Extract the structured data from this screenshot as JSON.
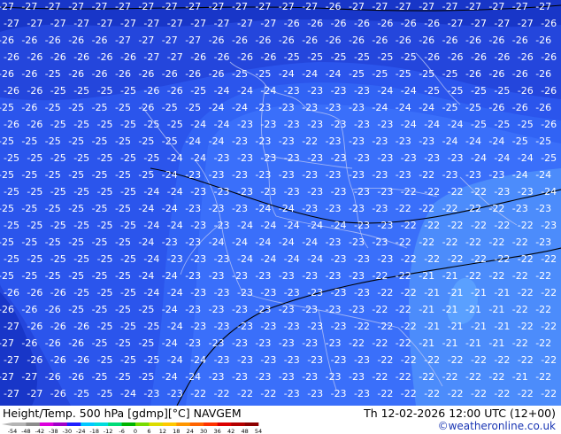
{
  "title": {
    "left": "Height/Temp. 500 hPa [gdmp][°C] NAVGEM",
    "right": "Th 12-02-2026 12:00 UTC (12+00)"
  },
  "credit": "©weatheronline.co.uk",
  "colorbar": {
    "ticks": [
      "-54",
      "-48",
      "-42",
      "-38",
      "-30",
      "-24",
      "-18",
      "-12",
      "-6",
      "0",
      "6",
      "12",
      "18",
      "24",
      "30",
      "36",
      "42",
      "48",
      "54"
    ],
    "colors": [
      "#b4b4b4",
      "#8c8c8c",
      "#dc00dc",
      "#a000c8",
      "#1e1eff",
      "#00c8ff",
      "#00dcdc",
      "#00dc78",
      "#00b400",
      "#78dc00",
      "#dcdc00",
      "#ffc800",
      "#ff9600",
      "#ff6400",
      "#ff3200",
      "#dc0000",
      "#b40000",
      "#8c0000"
    ]
  },
  "field": {
    "label_color": "#ffffff",
    "colors": {
      "c27": "#1836c8",
      "c26": "#2446dc",
      "c25": "#2b55ec",
      "c24": "#3163f4",
      "c23": "#3a6ffa",
      "c22": "#4c8cfb",
      "c21": "#5aa0ff"
    },
    "rows": [
      [
        -27,
        -27,
        -27,
        -27,
        -27,
        -27,
        -27,
        -27,
        -27,
        -27,
        -27,
        -27,
        -27,
        -27,
        -26,
        -27,
        -27,
        -27,
        -27,
        -27,
        -27,
        -27,
        -27,
        -27
      ],
      [
        -27,
        -27,
        -27,
        -27,
        -27,
        -27,
        -27,
        -27,
        -27,
        -27,
        -27,
        -27,
        -26,
        -26,
        -26,
        -26,
        -26,
        -26,
        -26,
        -27,
        -27,
        -27,
        -27,
        -26
      ],
      [
        -26,
        -26,
        -26,
        -26,
        -26,
        -27,
        -27,
        -27,
        -27,
        -26,
        -26,
        -26,
        -26,
        -26,
        -26,
        -26,
        -26,
        -26,
        -26,
        -26,
        -26,
        -26,
        -26,
        -26
      ],
      [
        -26,
        -26,
        -26,
        -26,
        -26,
        -26,
        -27,
        -27,
        -26,
        -26,
        -26,
        -26,
        -25,
        -25,
        -25,
        -25,
        -25,
        -25,
        -26,
        -26,
        -26,
        -26,
        -26,
        -26
      ],
      [
        -26,
        -26,
        -25,
        -26,
        -26,
        -26,
        -26,
        -26,
        -26,
        -26,
        -25,
        -25,
        -24,
        -24,
        -24,
        -25,
        -25,
        -25,
        -25,
        -25,
        -26,
        -26,
        -26,
        -26
      ],
      [
        -26,
        -26,
        -25,
        -25,
        -25,
        -25,
        -26,
        -26,
        -25,
        -24,
        -24,
        -24,
        -23,
        -23,
        -23,
        -23,
        -24,
        -24,
        -25,
        -25,
        -25,
        -25,
        -26,
        -26
      ],
      [
        -25,
        -26,
        -25,
        -25,
        -25,
        -25,
        -26,
        -25,
        -25,
        -24,
        -24,
        -23,
        -23,
        -23,
        -23,
        -23,
        -24,
        -24,
        -24,
        -25,
        -25,
        -26,
        -26,
        -26
      ],
      [
        -26,
        -26,
        -25,
        -25,
        -25,
        -25,
        -25,
        -25,
        -24,
        -24,
        -23,
        -23,
        -23,
        -23,
        -23,
        -23,
        -23,
        -24,
        -24,
        -24,
        -25,
        -25,
        -25,
        -26
      ],
      [
        -25,
        -25,
        -25,
        -25,
        -25,
        -25,
        -25,
        -25,
        -24,
        -24,
        -23,
        -23,
        -23,
        -22,
        -23,
        -23,
        -23,
        -23,
        -23,
        -24,
        -24,
        -24,
        -25,
        -25
      ],
      [
        -25,
        -25,
        -25,
        -25,
        -25,
        -25,
        -25,
        -24,
        -24,
        -23,
        -23,
        -23,
        -23,
        -23,
        -23,
        -23,
        -23,
        -23,
        -23,
        -23,
        -24,
        -24,
        -24,
        -25
      ],
      [
        -25,
        -25,
        -25,
        -25,
        -25,
        -25,
        -25,
        -24,
        -23,
        -23,
        -23,
        -23,
        -23,
        -23,
        -23,
        -23,
        -23,
        -23,
        -22,
        -23,
        -23,
        -23,
        -24,
        -24
      ],
      [
        -25,
        -25,
        -25,
        -25,
        -25,
        -25,
        -24,
        -24,
        -23,
        -23,
        -23,
        -23,
        -23,
        -23,
        -23,
        -23,
        -23,
        -22,
        -22,
        -22,
        -22,
        -23,
        -23,
        -24
      ],
      [
        -25,
        -25,
        -25,
        -25,
        -25,
        -25,
        -24,
        -24,
        -23,
        -23,
        -23,
        -24,
        -24,
        -23,
        -23,
        -23,
        -23,
        -22,
        -22,
        -22,
        -22,
        -22,
        -23,
        -23
      ],
      [
        -25,
        -25,
        -25,
        -25,
        -25,
        -25,
        -24,
        -24,
        -23,
        -23,
        -24,
        -24,
        -24,
        -24,
        -24,
        -23,
        -23,
        -22,
        -22,
        -22,
        -22,
        -22,
        -22,
        -23
      ],
      [
        -25,
        -25,
        -25,
        -25,
        -25,
        -25,
        -24,
        -23,
        -23,
        -24,
        -24,
        -24,
        -24,
        -24,
        -23,
        -23,
        -23,
        -22,
        -22,
        -22,
        -22,
        -22,
        -22,
        -23
      ],
      [
        -25,
        -25,
        -25,
        -25,
        -25,
        -25,
        -24,
        -23,
        -23,
        -23,
        -24,
        -24,
        -24,
        -24,
        -23,
        -23,
        -23,
        -22,
        -22,
        -22,
        -22,
        -22,
        -22,
        -22
      ],
      [
        -25,
        -25,
        -25,
        -25,
        -25,
        -25,
        -24,
        -24,
        -23,
        -23,
        -23,
        -23,
        -23,
        -23,
        -23,
        -23,
        -22,
        -22,
        -21,
        -21,
        -22,
        -22,
        -22,
        -22
      ],
      [
        -26,
        -26,
        -26,
        -25,
        -25,
        -25,
        -24,
        -24,
        -23,
        -23,
        -23,
        -23,
        -23,
        -23,
        -23,
        -23,
        -22,
        -22,
        -21,
        -21,
        -21,
        -21,
        -22,
        -22
      ],
      [
        -26,
        -26,
        -26,
        -25,
        -25,
        -25,
        -25,
        -24,
        -23,
        -23,
        -23,
        -23,
        -23,
        -23,
        -23,
        -23,
        -22,
        -22,
        -21,
        -21,
        -21,
        -21,
        -22,
        -22
      ],
      [
        -27,
        -26,
        -26,
        -26,
        -25,
        -25,
        -25,
        -24,
        -23,
        -23,
        -23,
        -23,
        -23,
        -23,
        -23,
        -22,
        -22,
        -22,
        -21,
        -21,
        -21,
        -21,
        -22,
        -22
      ],
      [
        -27,
        -26,
        -26,
        -26,
        -25,
        -25,
        -25,
        -24,
        -23,
        -23,
        -23,
        -23,
        -23,
        -23,
        -23,
        -22,
        -22,
        -22,
        -21,
        -21,
        -21,
        -21,
        -22,
        -22
      ],
      [
        -27,
        -26,
        -26,
        -26,
        -25,
        -25,
        -25,
        -24,
        -24,
        -23,
        -23,
        -23,
        -23,
        -23,
        -23,
        -23,
        -22,
        -22,
        -22,
        -22,
        -22,
        -22,
        -22,
        -22
      ],
      [
        -27,
        -27,
        -26,
        -26,
        -25,
        -25,
        -25,
        -24,
        -24,
        -23,
        -23,
        -23,
        -23,
        -23,
        -23,
        -23,
        -22,
        -22,
        -22,
        -22,
        -22,
        -22,
        -21,
        -22
      ],
      [
        -27,
        -27,
        -26,
        -25,
        -25,
        -24,
        -23,
        -23,
        -22,
        -22,
        -22,
        -22,
        -23,
        -23,
        -23,
        -23,
        -22,
        -22,
        -22,
        -22,
        -22,
        -22,
        -22,
        -22
      ]
    ]
  }
}
